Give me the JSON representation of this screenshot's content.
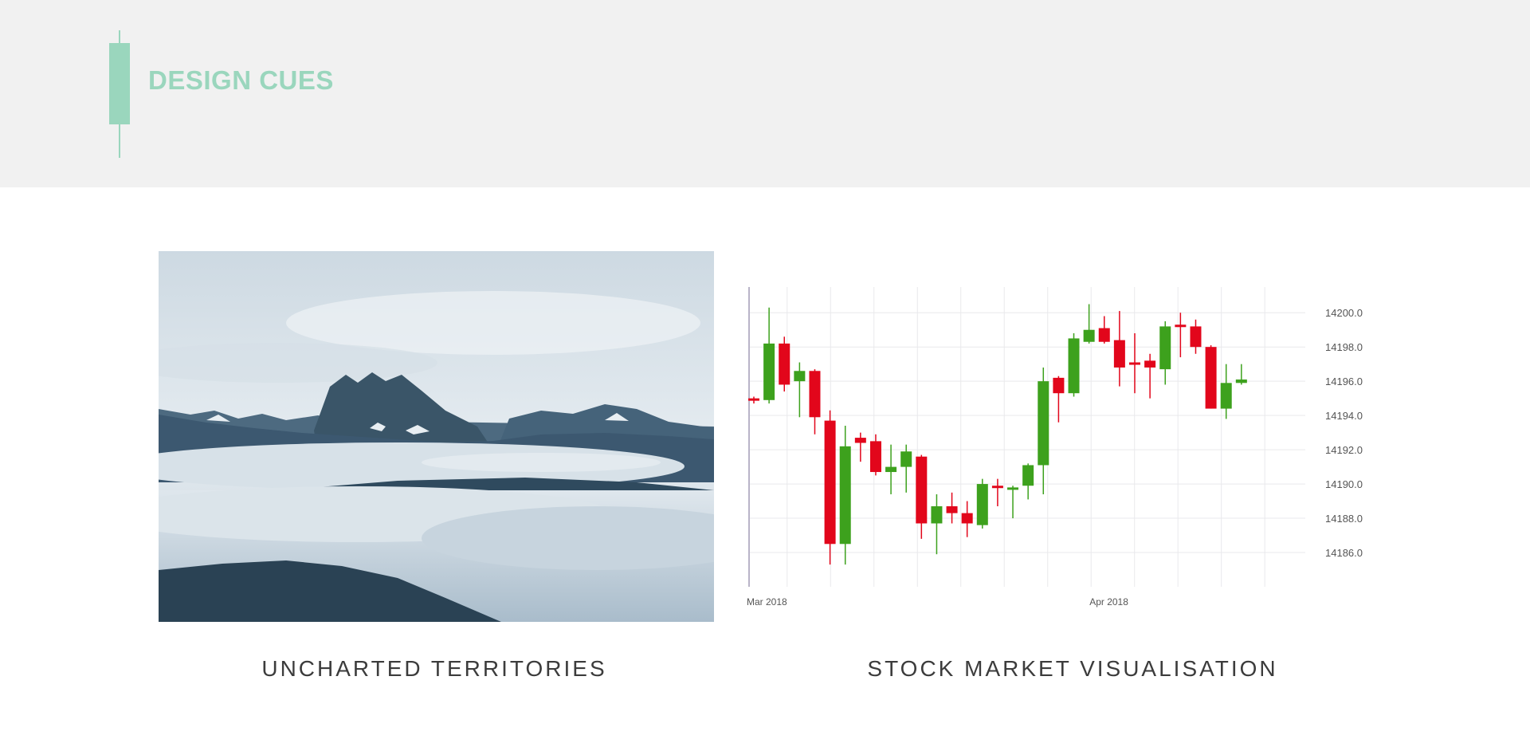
{
  "header": {
    "title": "DESIGN CUES",
    "accent_color": "#9ad6bd",
    "logo_icon": "candlestick-icon"
  },
  "cards": [
    {
      "caption": "UNCHARTED TERRITORIES",
      "image": "misty-mountain-landscape"
    },
    {
      "caption": "STOCK MARKET VISUALISATION"
    }
  ],
  "chart_data": {
    "type": "candlestick",
    "title": "",
    "x_tick_labels": [
      {
        "label": "Mar 2018",
        "index": 0
      },
      {
        "label": "Apr 2018",
        "index": 22.5
      }
    ],
    "y_ticks": [
      "14186.0",
      "14188.0",
      "14190.0",
      "14192.0",
      "14194.0",
      "14196.0",
      "14198.0",
      "14200.0"
    ],
    "ylim": [
      14184.0,
      14201.5
    ],
    "grid": true,
    "colors": {
      "up": "#3da11d",
      "down": "#e2061b"
    },
    "candles": [
      {
        "open": 14195.0,
        "high": 14195.1,
        "low": 14194.7,
        "close": 14194.9
      },
      {
        "open": 14194.9,
        "high": 14200.3,
        "low": 14194.7,
        "close": 14198.2
      },
      {
        "open": 14198.2,
        "high": 14198.6,
        "low": 14195.4,
        "close": 14195.8
      },
      {
        "open": 14196.0,
        "high": 14197.1,
        "low": 14193.9,
        "close": 14196.6
      },
      {
        "open": 14196.6,
        "high": 14196.7,
        "low": 14192.9,
        "close": 14193.9
      },
      {
        "open": 14193.7,
        "high": 14194.3,
        "low": 14185.3,
        "close": 14186.5
      },
      {
        "open": 14186.5,
        "high": 14193.4,
        "low": 14185.3,
        "close": 14192.2
      },
      {
        "open": 14192.7,
        "high": 14193.0,
        "low": 14191.3,
        "close": 14192.4
      },
      {
        "open": 14192.5,
        "high": 14192.9,
        "low": 14190.5,
        "close": 14190.7
      },
      {
        "open": 14190.7,
        "high": 14192.3,
        "low": 14189.4,
        "close": 14191.0
      },
      {
        "open": 14191.0,
        "high": 14192.3,
        "low": 14189.5,
        "close": 14191.9
      },
      {
        "open": 14191.6,
        "high": 14191.7,
        "low": 14186.8,
        "close": 14187.7
      },
      {
        "open": 14187.7,
        "high": 14189.4,
        "low": 14185.9,
        "close": 14188.7
      },
      {
        "open": 14188.7,
        "high": 14189.5,
        "low": 14187.7,
        "close": 14188.3
      },
      {
        "open": 14188.3,
        "high": 14189.0,
        "low": 14186.9,
        "close": 14187.7
      },
      {
        "open": 14187.6,
        "high": 14190.3,
        "low": 14187.4,
        "close": 14190.0
      },
      {
        "open": 14189.9,
        "high": 14190.3,
        "low": 14188.7,
        "close": 14189.8
      },
      {
        "open": 14189.7,
        "high": 14189.9,
        "low": 14188.0,
        "close": 14189.8
      },
      {
        "open": 14189.9,
        "high": 14191.2,
        "low": 14189.1,
        "close": 14191.1
      },
      {
        "open": 14191.1,
        "high": 14196.8,
        "low": 14189.4,
        "close": 14196.0
      },
      {
        "open": 14196.2,
        "high": 14196.3,
        "low": 14193.6,
        "close": 14195.3
      },
      {
        "open": 14195.3,
        "high": 14198.8,
        "low": 14195.1,
        "close": 14198.5
      },
      {
        "open": 14198.3,
        "high": 14200.5,
        "low": 14198.2,
        "close": 14199.0
      },
      {
        "open": 14199.1,
        "high": 14199.8,
        "low": 14198.2,
        "close": 14198.3
      },
      {
        "open": 14198.4,
        "high": 14200.1,
        "low": 14195.7,
        "close": 14196.8
      },
      {
        "open": 14197.1,
        "high": 14198.8,
        "low": 14195.3,
        "close": 14197.0
      },
      {
        "open": 14197.2,
        "high": 14197.6,
        "low": 14195.0,
        "close": 14196.8
      },
      {
        "open": 14196.7,
        "high": 14199.5,
        "low": 14195.8,
        "close": 14199.2
      },
      {
        "open": 14199.3,
        "high": 14200.0,
        "low": 14197.4,
        "close": 14199.2
      },
      {
        "open": 14199.2,
        "high": 14199.6,
        "low": 14197.6,
        "close": 14198.0
      },
      {
        "open": 14198.0,
        "high": 14198.1,
        "low": 14194.4,
        "close": 14194.4
      },
      {
        "open": 14194.4,
        "high": 14197.0,
        "low": 14193.8,
        "close": 14195.9
      },
      {
        "open": 14195.9,
        "high": 14197.0,
        "low": 14195.8,
        "close": 14196.1
      }
    ]
  }
}
